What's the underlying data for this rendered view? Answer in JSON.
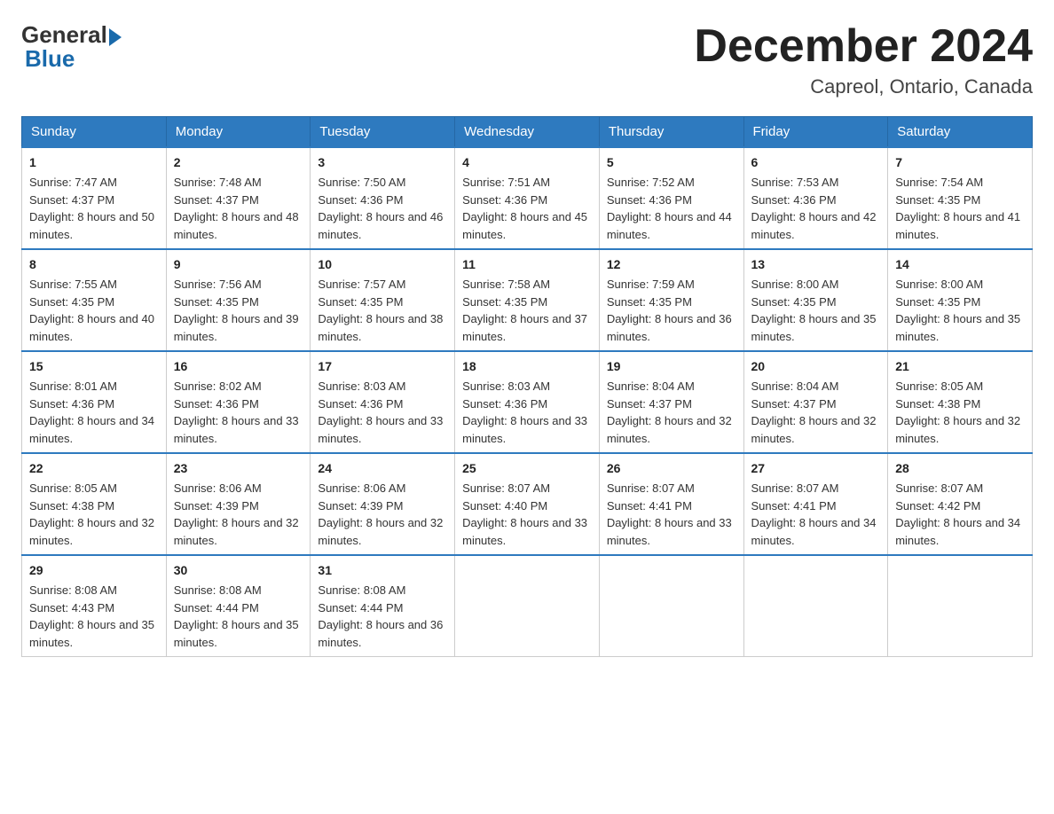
{
  "header": {
    "logo_general": "General",
    "logo_blue": "Blue",
    "month_title": "December 2024",
    "location": "Capreol, Ontario, Canada"
  },
  "days_of_week": [
    "Sunday",
    "Monday",
    "Tuesday",
    "Wednesday",
    "Thursday",
    "Friday",
    "Saturday"
  ],
  "weeks": [
    [
      {
        "day": "1",
        "sunrise": "7:47 AM",
        "sunset": "4:37 PM",
        "daylight": "8 hours and 50 minutes."
      },
      {
        "day": "2",
        "sunrise": "7:48 AM",
        "sunset": "4:37 PM",
        "daylight": "8 hours and 48 minutes."
      },
      {
        "day": "3",
        "sunrise": "7:50 AM",
        "sunset": "4:36 PM",
        "daylight": "8 hours and 46 minutes."
      },
      {
        "day": "4",
        "sunrise": "7:51 AM",
        "sunset": "4:36 PM",
        "daylight": "8 hours and 45 minutes."
      },
      {
        "day": "5",
        "sunrise": "7:52 AM",
        "sunset": "4:36 PM",
        "daylight": "8 hours and 44 minutes."
      },
      {
        "day": "6",
        "sunrise": "7:53 AM",
        "sunset": "4:36 PM",
        "daylight": "8 hours and 42 minutes."
      },
      {
        "day": "7",
        "sunrise": "7:54 AM",
        "sunset": "4:35 PM",
        "daylight": "8 hours and 41 minutes."
      }
    ],
    [
      {
        "day": "8",
        "sunrise": "7:55 AM",
        "sunset": "4:35 PM",
        "daylight": "8 hours and 40 minutes."
      },
      {
        "day": "9",
        "sunrise": "7:56 AM",
        "sunset": "4:35 PM",
        "daylight": "8 hours and 39 minutes."
      },
      {
        "day": "10",
        "sunrise": "7:57 AM",
        "sunset": "4:35 PM",
        "daylight": "8 hours and 38 minutes."
      },
      {
        "day": "11",
        "sunrise": "7:58 AM",
        "sunset": "4:35 PM",
        "daylight": "8 hours and 37 minutes."
      },
      {
        "day": "12",
        "sunrise": "7:59 AM",
        "sunset": "4:35 PM",
        "daylight": "8 hours and 36 minutes."
      },
      {
        "day": "13",
        "sunrise": "8:00 AM",
        "sunset": "4:35 PM",
        "daylight": "8 hours and 35 minutes."
      },
      {
        "day": "14",
        "sunrise": "8:00 AM",
        "sunset": "4:35 PM",
        "daylight": "8 hours and 35 minutes."
      }
    ],
    [
      {
        "day": "15",
        "sunrise": "8:01 AM",
        "sunset": "4:36 PM",
        "daylight": "8 hours and 34 minutes."
      },
      {
        "day": "16",
        "sunrise": "8:02 AM",
        "sunset": "4:36 PM",
        "daylight": "8 hours and 33 minutes."
      },
      {
        "day": "17",
        "sunrise": "8:03 AM",
        "sunset": "4:36 PM",
        "daylight": "8 hours and 33 minutes."
      },
      {
        "day": "18",
        "sunrise": "8:03 AM",
        "sunset": "4:36 PM",
        "daylight": "8 hours and 33 minutes."
      },
      {
        "day": "19",
        "sunrise": "8:04 AM",
        "sunset": "4:37 PM",
        "daylight": "8 hours and 32 minutes."
      },
      {
        "day": "20",
        "sunrise": "8:04 AM",
        "sunset": "4:37 PM",
        "daylight": "8 hours and 32 minutes."
      },
      {
        "day": "21",
        "sunrise": "8:05 AM",
        "sunset": "4:38 PM",
        "daylight": "8 hours and 32 minutes."
      }
    ],
    [
      {
        "day": "22",
        "sunrise": "8:05 AM",
        "sunset": "4:38 PM",
        "daylight": "8 hours and 32 minutes."
      },
      {
        "day": "23",
        "sunrise": "8:06 AM",
        "sunset": "4:39 PM",
        "daylight": "8 hours and 32 minutes."
      },
      {
        "day": "24",
        "sunrise": "8:06 AM",
        "sunset": "4:39 PM",
        "daylight": "8 hours and 32 minutes."
      },
      {
        "day": "25",
        "sunrise": "8:07 AM",
        "sunset": "4:40 PM",
        "daylight": "8 hours and 33 minutes."
      },
      {
        "day": "26",
        "sunrise": "8:07 AM",
        "sunset": "4:41 PM",
        "daylight": "8 hours and 33 minutes."
      },
      {
        "day": "27",
        "sunrise": "8:07 AM",
        "sunset": "4:41 PM",
        "daylight": "8 hours and 34 minutes."
      },
      {
        "day": "28",
        "sunrise": "8:07 AM",
        "sunset": "4:42 PM",
        "daylight": "8 hours and 34 minutes."
      }
    ],
    [
      {
        "day": "29",
        "sunrise": "8:08 AM",
        "sunset": "4:43 PM",
        "daylight": "8 hours and 35 minutes."
      },
      {
        "day": "30",
        "sunrise": "8:08 AM",
        "sunset": "4:44 PM",
        "daylight": "8 hours and 35 minutes."
      },
      {
        "day": "31",
        "sunrise": "8:08 AM",
        "sunset": "4:44 PM",
        "daylight": "8 hours and 36 minutes."
      },
      null,
      null,
      null,
      null
    ]
  ]
}
